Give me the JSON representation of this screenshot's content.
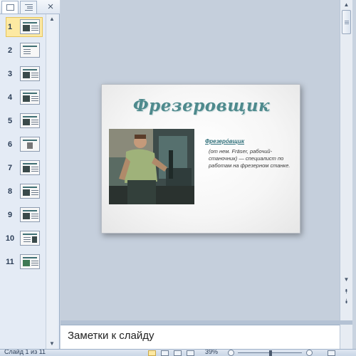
{
  "left_pane": {
    "tabs": [
      {
        "name": "slides-tab-icon",
        "selected": true
      },
      {
        "name": "outline-tab-icon",
        "selected": false
      }
    ],
    "close_glyph": "×",
    "thumbnails": [
      {
        "number": "1",
        "selected": true
      },
      {
        "number": "2",
        "selected": false
      },
      {
        "number": "3",
        "selected": false
      },
      {
        "number": "4",
        "selected": false
      },
      {
        "number": "5",
        "selected": false
      },
      {
        "number": "6",
        "selected": false
      },
      {
        "number": "7",
        "selected": false
      },
      {
        "number": "8",
        "selected": false
      },
      {
        "number": "9",
        "selected": false
      },
      {
        "number": "10",
        "selected": false
      },
      {
        "number": "11",
        "selected": false
      }
    ]
  },
  "slide": {
    "title": "Фрезеровщик",
    "link_text": "Фрезеро́вщик",
    "body_text": "(от нем. Fräser, рабочий-станочник) — специалист по работам на фрезерном станке.",
    "title_color": "#4e8a8d"
  },
  "notes": {
    "placeholder": "Заметки к слайду"
  },
  "status_bar": {
    "slide_info": "Слайд 1 из 11",
    "zoom_level": "39%"
  },
  "icons": {
    "scroll_up": "▲",
    "scroll_down": "▼",
    "prev_slide": "⯭",
    "next_slide": "⯯"
  }
}
